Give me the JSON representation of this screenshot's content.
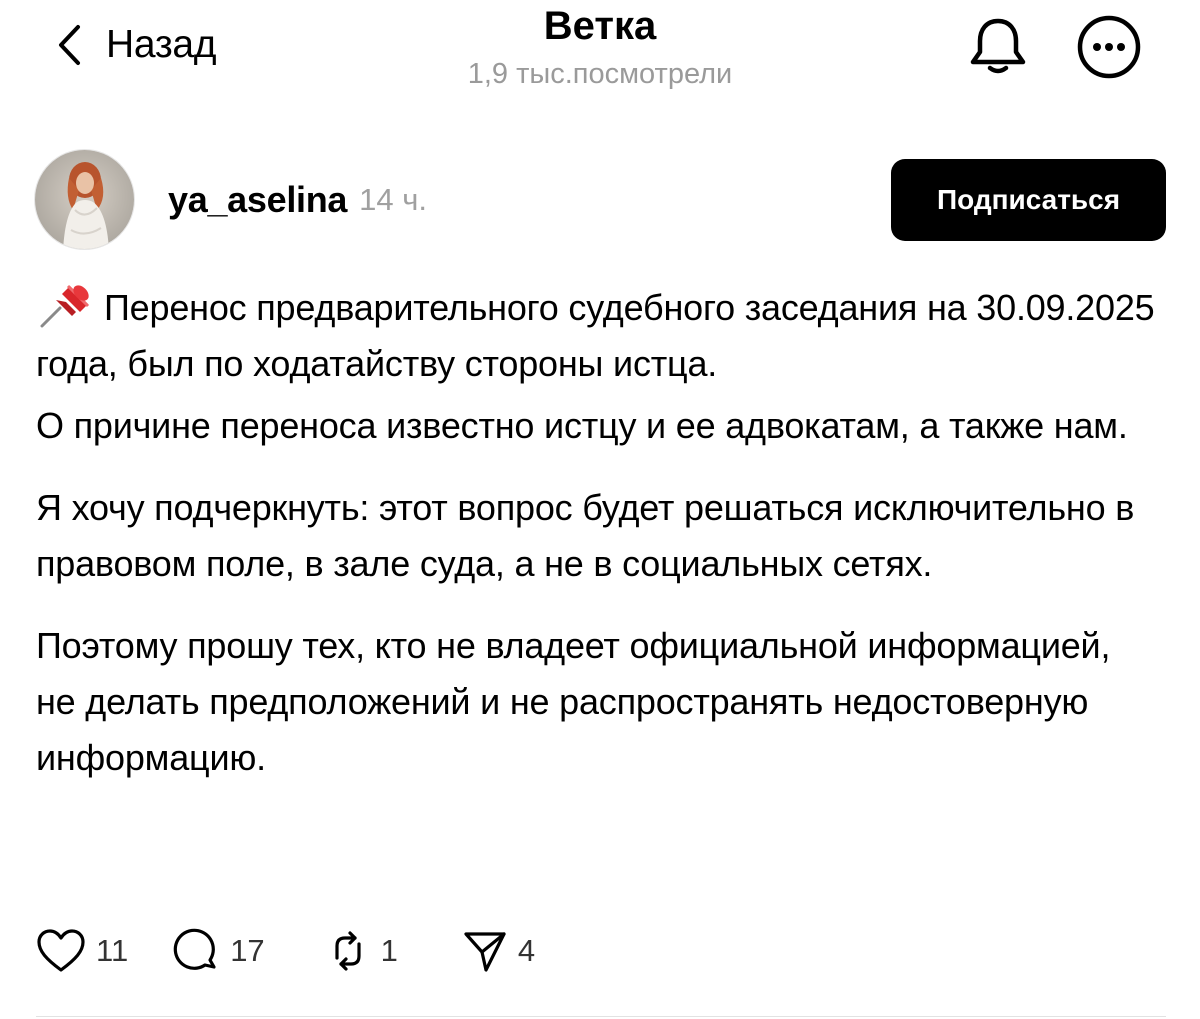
{
  "header": {
    "back_label": "Назад",
    "title": "Ветка",
    "views": "1,9 тыс.посмотрели",
    "icons": {
      "back": "chevron-left-icon",
      "notifications": "bell-icon",
      "more": "more-options-icon"
    }
  },
  "post": {
    "author": {
      "username": "ya_aselina",
      "time": "14 ч."
    },
    "subscribe_label": "Подписаться",
    "pin_icon": "pushpin-icon",
    "paragraphs": [
      "Перенос предварительного судебного заседания на 30.09.2025 года, был  по ходатайству стороны истца.",
      "О причине переноса известно истцу и ее адвокатам, а также нам.",
      "Я хочу подчеркнуть: этот вопрос будет решаться исключительно в правовом поле, в зале суда, а не в социальных сетях.",
      "Поэтому прошу тех, кто не владеет официальной информацией, не делать предположений и не распространять недостоверную информацию."
    ],
    "actions": {
      "likes": "11",
      "comments": "17",
      "reposts": "1",
      "shares": "4"
    }
  },
  "colors": {
    "text": "#000000",
    "secondary": "#9a9a9a",
    "button_bg": "#000000",
    "button_text": "#ffffff",
    "pin_red": "#d9262b"
  }
}
